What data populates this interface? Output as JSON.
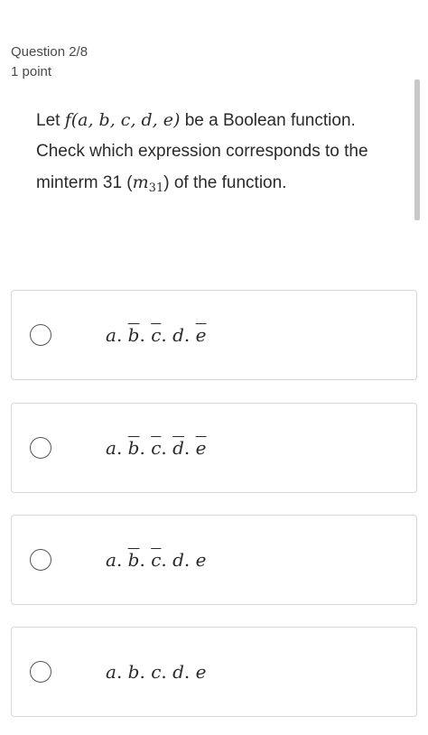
{
  "header": {
    "question_number": "Question 2/8",
    "points": "1 point"
  },
  "question": {
    "part1": "Let ",
    "func": "f(a, b, c, d, e)",
    "part2": " be a Boolean function.",
    "line2": "Check which expression corresponds to the",
    "line3_start": "minterm 31 (",
    "minterm_symbol": "m",
    "minterm_index": "31",
    "line3_end": ") of the function."
  },
  "options": [
    {
      "terms": [
        {
          "text": "a",
          "bar": false
        },
        {
          "text": "b",
          "bar": true
        },
        {
          "text": "c",
          "bar": true
        },
        {
          "text": "d",
          "bar": false
        },
        {
          "text": "e",
          "bar": true
        }
      ]
    },
    {
      "terms": [
        {
          "text": "a",
          "bar": false
        },
        {
          "text": "b",
          "bar": true
        },
        {
          "text": "c",
          "bar": true
        },
        {
          "text": "d",
          "bar": true
        },
        {
          "text": "e",
          "bar": true
        }
      ]
    },
    {
      "terms": [
        {
          "text": "a",
          "bar": false
        },
        {
          "text": "b",
          "bar": true
        },
        {
          "text": "c",
          "bar": true
        },
        {
          "text": "d",
          "bar": false
        },
        {
          "text": "e",
          "bar": false
        }
      ]
    },
    {
      "terms": [
        {
          "text": "a",
          "bar": false
        },
        {
          "text": "b",
          "bar": false
        },
        {
          "text": "c",
          "bar": false
        },
        {
          "text": "d",
          "bar": false
        },
        {
          "text": "e",
          "bar": false
        }
      ]
    }
  ],
  "separator": ". "
}
